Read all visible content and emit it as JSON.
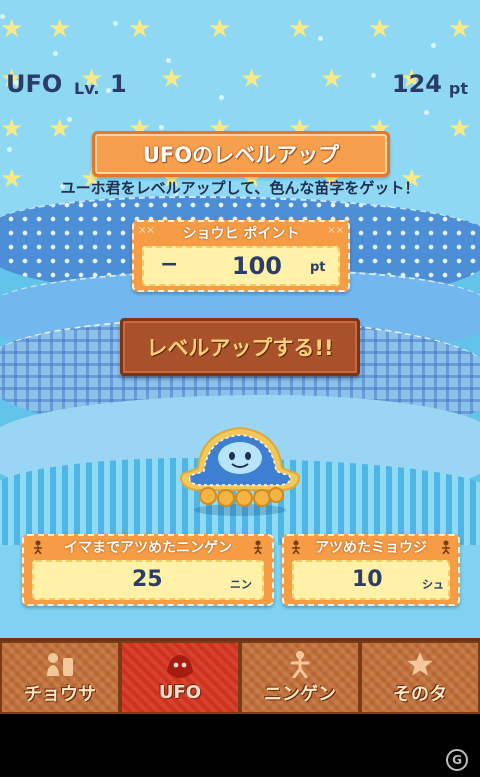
{
  "header": {
    "name": "UFO",
    "level_prefix": "Lv.",
    "level": "1",
    "points": "124",
    "points_unit": "pt"
  },
  "title": "UFOのレベルアップ",
  "subtitle": "ユーホ君をレベルアップして、色んな苗字をゲット！",
  "cost": {
    "label": "ショウヒ ポイント",
    "sign": "−",
    "value": "100",
    "unit": "pt"
  },
  "levelup_button": "レベルアップする!!",
  "stats": [
    {
      "label": "イマまでアツめたニンゲン",
      "value": "25",
      "unit": "ニン"
    },
    {
      "label": "アツめたミョウジ",
      "value": "10",
      "unit": "シュ"
    }
  ],
  "tabs": [
    {
      "label": "チョウサ",
      "icon": "investigate-icon",
      "active": false
    },
    {
      "label": "UFO",
      "icon": "ufo-icon",
      "active": true
    },
    {
      "label": "ニンゲン",
      "icon": "person-icon",
      "active": false
    },
    {
      "label": "そのタ",
      "icon": "star-icon",
      "active": false
    }
  ],
  "colors": {
    "sky": "#8ed8f3",
    "panel_orange": "#f59c45",
    "field_yellow": "#fff1a8",
    "text_navy": "#2b3d67",
    "button_brown": "#a8512a",
    "active_tab": "#d1321e"
  }
}
